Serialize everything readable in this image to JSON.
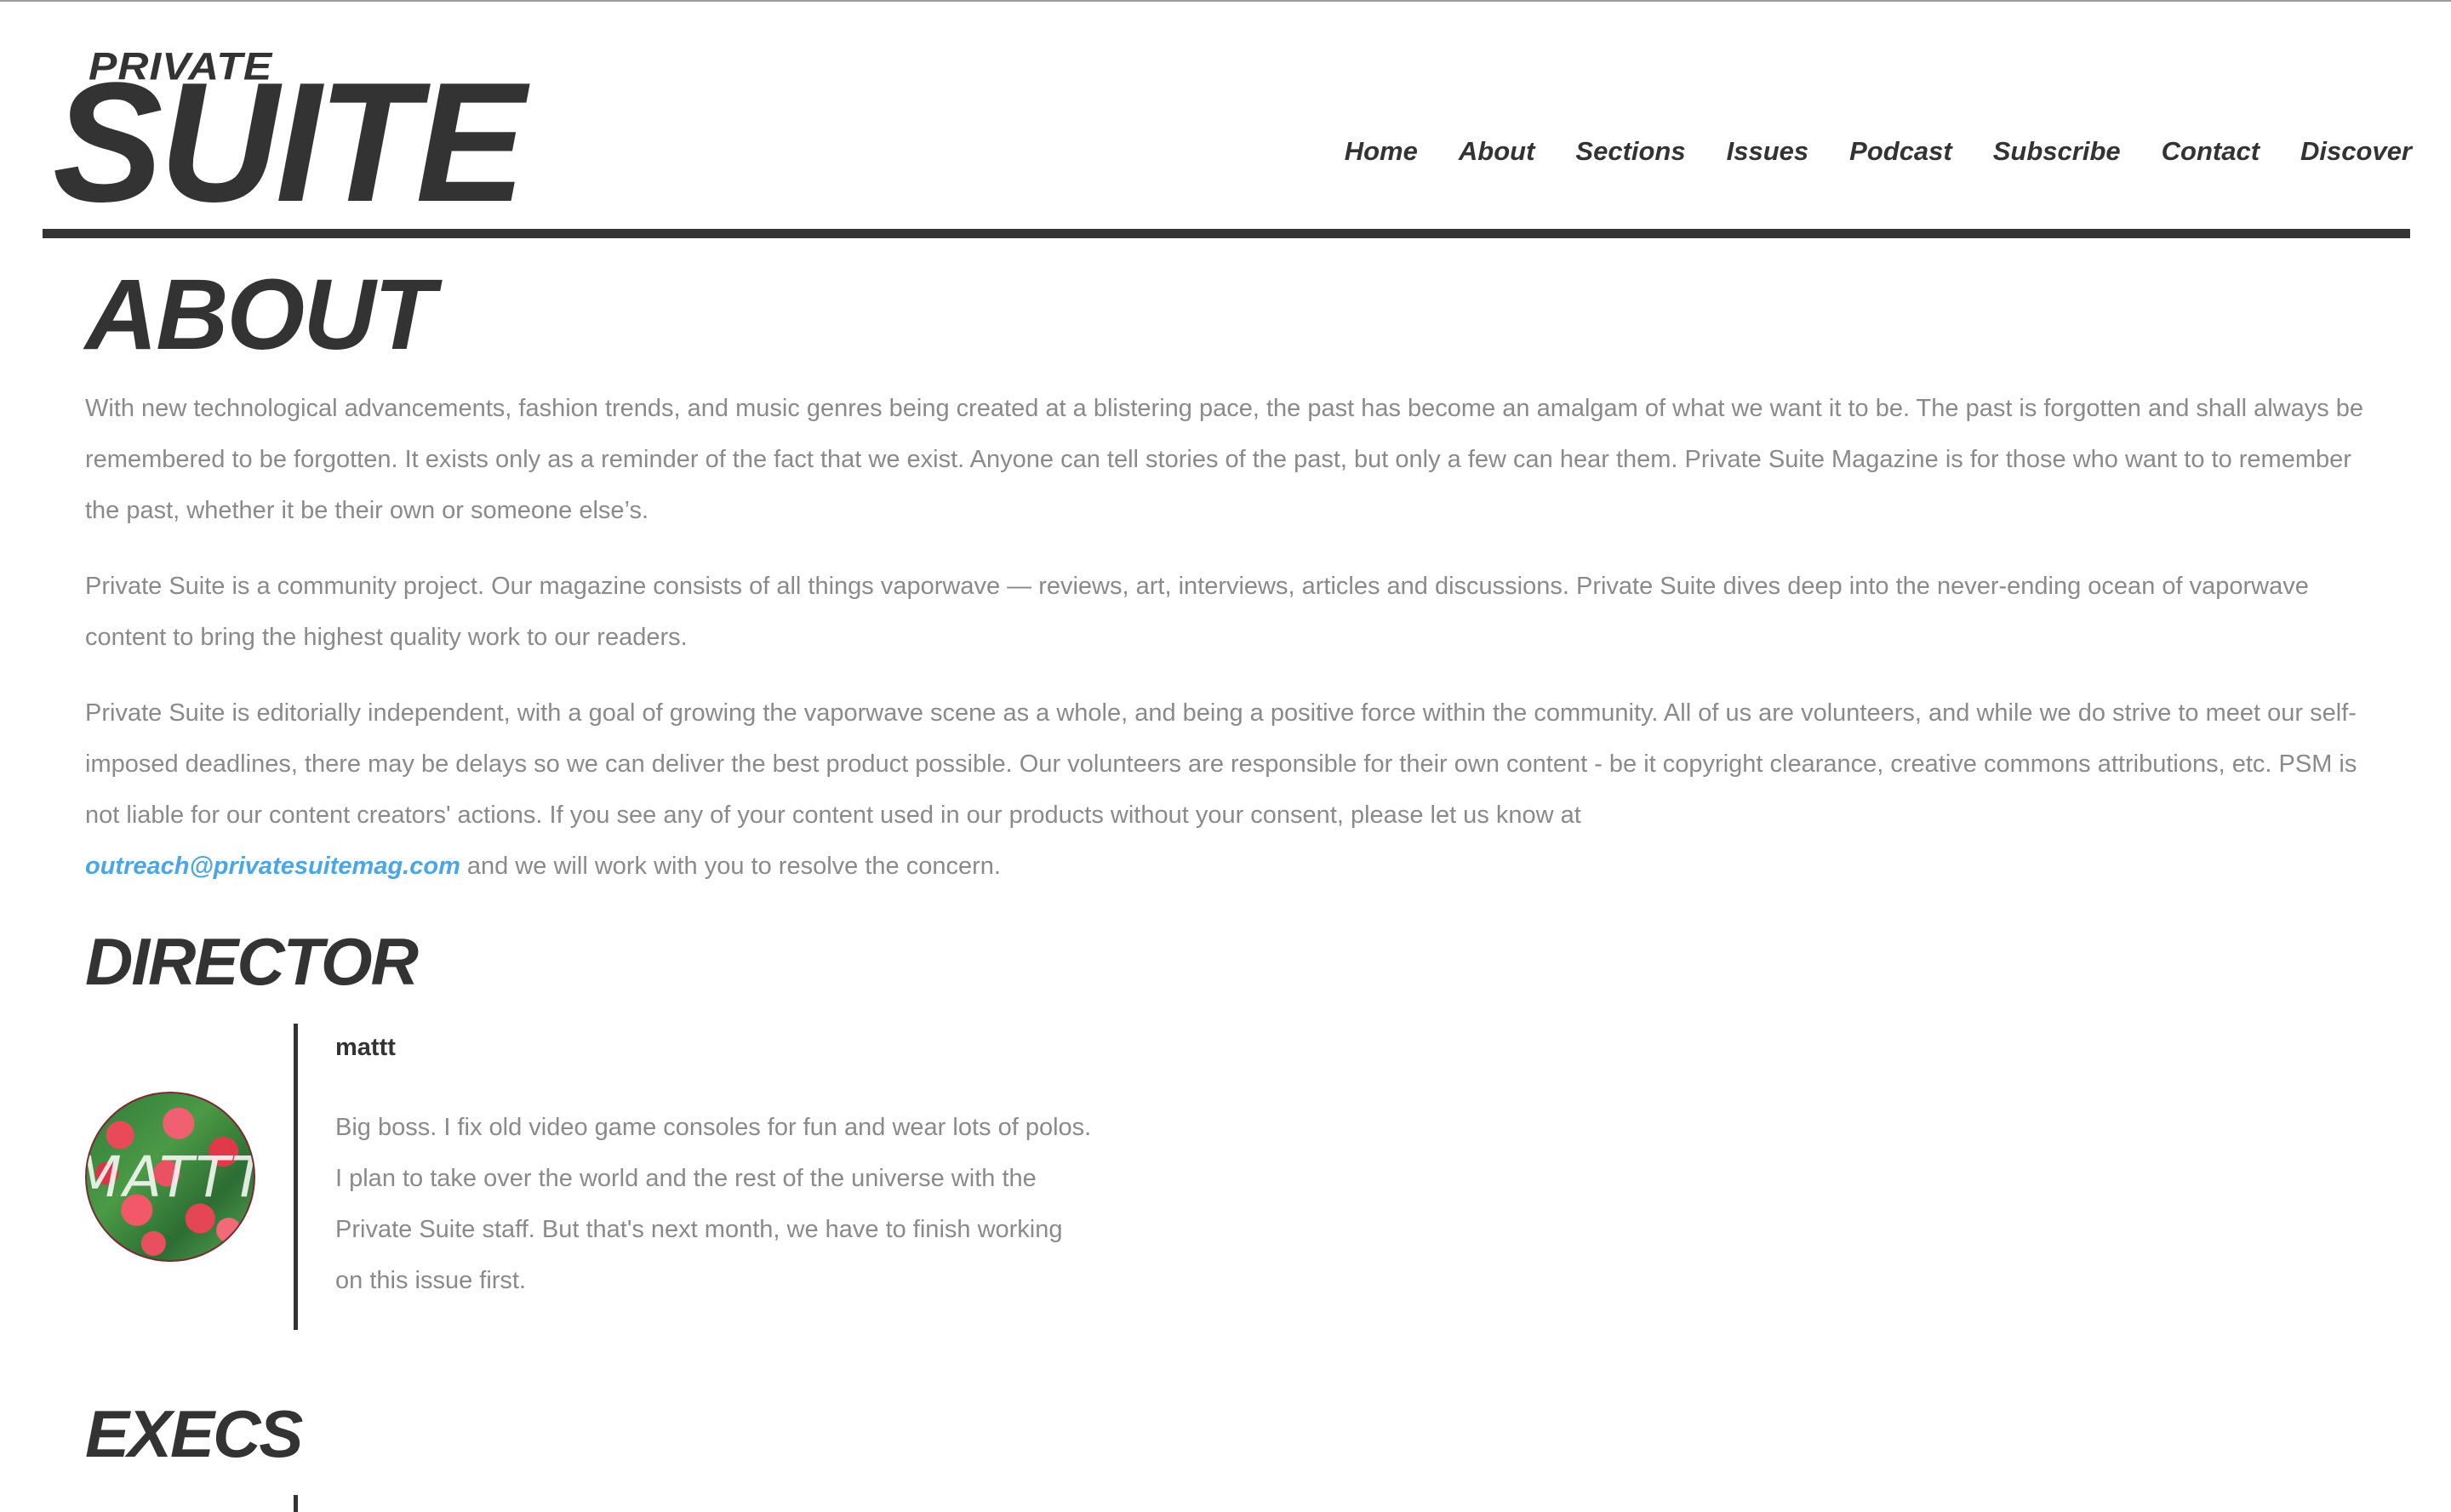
{
  "header": {
    "logo_top": "PRIVATE",
    "logo_main": "SUITE",
    "nav": [
      "Home",
      "About",
      "Sections",
      "Issues",
      "Podcast",
      "Subscribe",
      "Contact",
      "Discover"
    ]
  },
  "about": {
    "title": "ABOUT",
    "paragraphs": [
      "With new technological advancements, fashion trends, and music genres being created at a blistering pace, the past has become an amalgam of what we want it to be. The past is forgotten and shall always be remembered to be forgotten. It exists only as a reminder of the fact that we exist. Anyone can tell stories of the past, but only a few can hear them. Private Suite Magazine is for those who want to to remember the past, whether it be their own or someone else’s.",
      "Private Suite is a community project. Our magazine consists of all things vaporwave — reviews, art, interviews, articles and discussions. Private Suite dives deep into the never-ending ocean of vaporwave content to bring the highest quality work to our readers.",
      "Private Suite is editorially independent, with a goal of growing the vaporwave scene as a whole, and being a positive force within the community. All of us are volunteers, and while we do strive to meet our self-imposed deadlines, there may be delays so we can deliver the best product possible. Our volunteers are responsible for their own content - be it copyright clearance, creative commons attributions, etc. PSM is not liable for our content creators' actions. If you see any of your content used in our products without your consent, please let us know at"
    ],
    "email_link": "outreach@privatesuitemag.com",
    "closing": " and we will work with you to resolve the concern."
  },
  "director": {
    "title": "DIRECTOR",
    "name": "mattt",
    "avatar_text": "MATTT",
    "bio_lines": [
      "Big boss. I fix old video game consoles for fun and wear lots of polos.",
      "I plan to take over the world and the rest of the universe with the",
      "Private Suite staff. But that's next month, we have to finish working",
      "on this issue first."
    ]
  },
  "execs": {
    "title": "EXECS"
  }
}
